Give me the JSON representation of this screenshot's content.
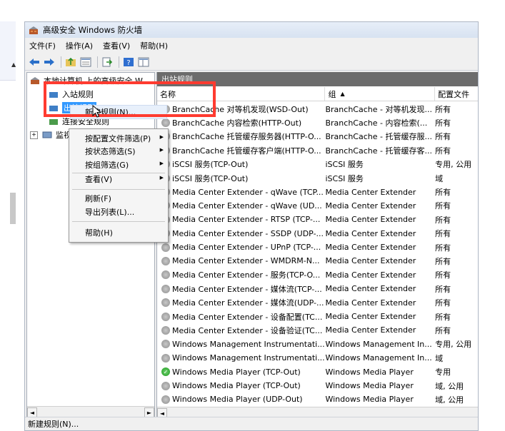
{
  "window": {
    "title": "高级安全 Windows 防火墙"
  },
  "menu": [
    "文件(F)",
    "操作(A)",
    "查看(V)",
    "帮助(H)"
  ],
  "toolbar": {
    "icons": [
      "back-icon",
      "forward-icon",
      "up-folder-icon",
      "properties-icon",
      "export-icon",
      "help-icon",
      "show-hide-pane-icon"
    ]
  },
  "tree": {
    "root_label": "本地计算机 上的高级安全 W...",
    "items": [
      {
        "label": "入站规则"
      },
      {
        "label": "出站规则"
      },
      {
        "label": "连接安全规则"
      },
      {
        "label": "监视"
      }
    ]
  },
  "list": {
    "pane_title": "出站规则",
    "columns": [
      "名称",
      "组",
      "配置文件"
    ],
    "sort_indicator": "▲",
    "rows": [
      {
        "name": "BranchCache 对等机发现(WSD-Out)",
        "group": "BranchCache - 对等机发现...",
        "profile": "所有",
        "enabled": false
      },
      {
        "name": "BranchCache 内容检索(HTTP-Out)",
        "group": "BranchCache - 内容检索(...",
        "profile": "所有",
        "enabled": false
      },
      {
        "name": "BranchCache 托管缓存服务器(HTTP-O...",
        "group": "BranchCache - 托管缓存服...",
        "profile": "所有",
        "enabled": false
      },
      {
        "name": "BranchCache 托管缓存客户端(HTTP-O...",
        "group": "BranchCache - 托管缓存客...",
        "profile": "所有",
        "enabled": false
      },
      {
        "name": "iSCSI 服务(TCP-Out)",
        "group": "iSCSI 服务",
        "profile": "专用, 公用",
        "enabled": false
      },
      {
        "name": "iSCSI 服务(TCP-Out)",
        "group": "iSCSI 服务",
        "profile": "域",
        "enabled": false
      },
      {
        "name": "Media Center Extender - qWave (TCP...",
        "group": "Media Center Extender",
        "profile": "所有",
        "enabled": false
      },
      {
        "name": "Media Center Extender - qWave (UD...",
        "group": "Media Center Extender",
        "profile": "所有",
        "enabled": false
      },
      {
        "name": "Media Center Extender - RTSP (TCP-...",
        "group": "Media Center Extender",
        "profile": "所有",
        "enabled": false
      },
      {
        "name": "Media Center Extender - SSDP (UDP-...",
        "group": "Media Center Extender",
        "profile": "所有",
        "enabled": false
      },
      {
        "name": "Media Center Extender - UPnP (TCP-...",
        "group": "Media Center Extender",
        "profile": "所有",
        "enabled": false
      },
      {
        "name": "Media Center Extender - WMDRM-N...",
        "group": "Media Center Extender",
        "profile": "所有",
        "enabled": false
      },
      {
        "name": "Media Center Extender - 服务(TCP-O...",
        "group": "Media Center Extender",
        "profile": "所有",
        "enabled": false
      },
      {
        "name": "Media Center Extender - 媒体流(TCP-...",
        "group": "Media Center Extender",
        "profile": "所有",
        "enabled": false
      },
      {
        "name": "Media Center Extender - 媒体流(UDP-...",
        "group": "Media Center Extender",
        "profile": "所有",
        "enabled": false
      },
      {
        "name": "Media Center Extender - 设备配置(TC...",
        "group": "Media Center Extender",
        "profile": "所有",
        "enabled": false
      },
      {
        "name": "Media Center Extender - 设备验证(TC...",
        "group": "Media Center Extender",
        "profile": "所有",
        "enabled": false
      },
      {
        "name": "Windows Management Instrumentati...",
        "group": "Windows Management In...",
        "profile": "专用, 公用",
        "enabled": false
      },
      {
        "name": "Windows Management Instrumentati...",
        "group": "Windows Management In...",
        "profile": "域",
        "enabled": false
      },
      {
        "name": "Windows Media Player (TCP-Out)",
        "group": "Windows Media Player",
        "profile": "专用",
        "enabled": true
      },
      {
        "name": "Windows Media Player (TCP-Out)",
        "group": "Windows Media Player",
        "profile": "域, 公用",
        "enabled": false
      },
      {
        "name": "Windows Media Player (UDP-Out)",
        "group": "Windows Media Player",
        "profile": "域, 公用",
        "enabled": false
      }
    ]
  },
  "context_menu": {
    "items": [
      {
        "label": "新建规则(N)..."
      },
      {
        "label": "按配置文件筛选(P)",
        "submenu": true
      },
      {
        "label": "按状态筛选(S)",
        "submenu": true
      },
      {
        "label": "按组筛选(G)",
        "submenu": true
      },
      {
        "label": "查看(V)",
        "submenu": true
      },
      {
        "label": "刷新(F)"
      },
      {
        "label": "导出列表(L)..."
      },
      {
        "label": "帮助(H)"
      }
    ]
  },
  "status_bar": {
    "text": "新建规则(N)..."
  },
  "colors": {
    "highlight": "#ff3b30",
    "selection": "#3399ff",
    "pane_header": "#6c6c6c"
  }
}
